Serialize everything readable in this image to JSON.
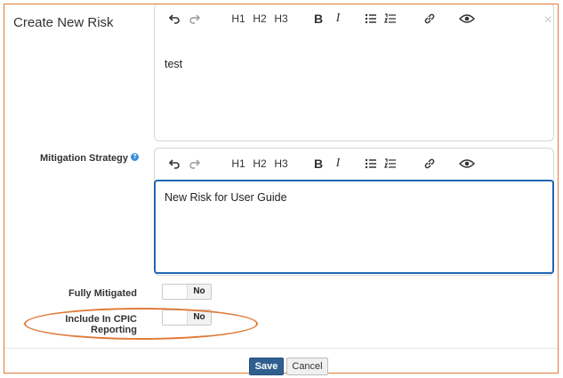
{
  "dialog": {
    "title": "Create New Risk",
    "close_glyph": "×"
  },
  "editors": {
    "description": {
      "content": "test",
      "toolbar": {
        "undo": "↶",
        "redo": "↷",
        "h1": "H1",
        "h2": "H2",
        "h3": "H3",
        "bold": "B",
        "italic": "I"
      }
    },
    "mitigation": {
      "label": "Mitigation Strategy",
      "help_glyph": "?",
      "content": "New Risk for User Guide",
      "toolbar": {
        "h1": "H1",
        "h2": "H2",
        "h3": "H3",
        "bold": "B",
        "italic": "I"
      }
    }
  },
  "fields": {
    "fully_mitigated": {
      "label": "Fully Mitigated",
      "value": "No"
    },
    "include_cpic": {
      "label": "Include In CPIC Reporting",
      "value": "No"
    }
  },
  "footer": {
    "save_label": "Save",
    "cancel_label": "Cancel"
  },
  "colors": {
    "highlight": "#e07b39",
    "primary": "#2f5f8f",
    "focus_border": "#1f67b1"
  }
}
